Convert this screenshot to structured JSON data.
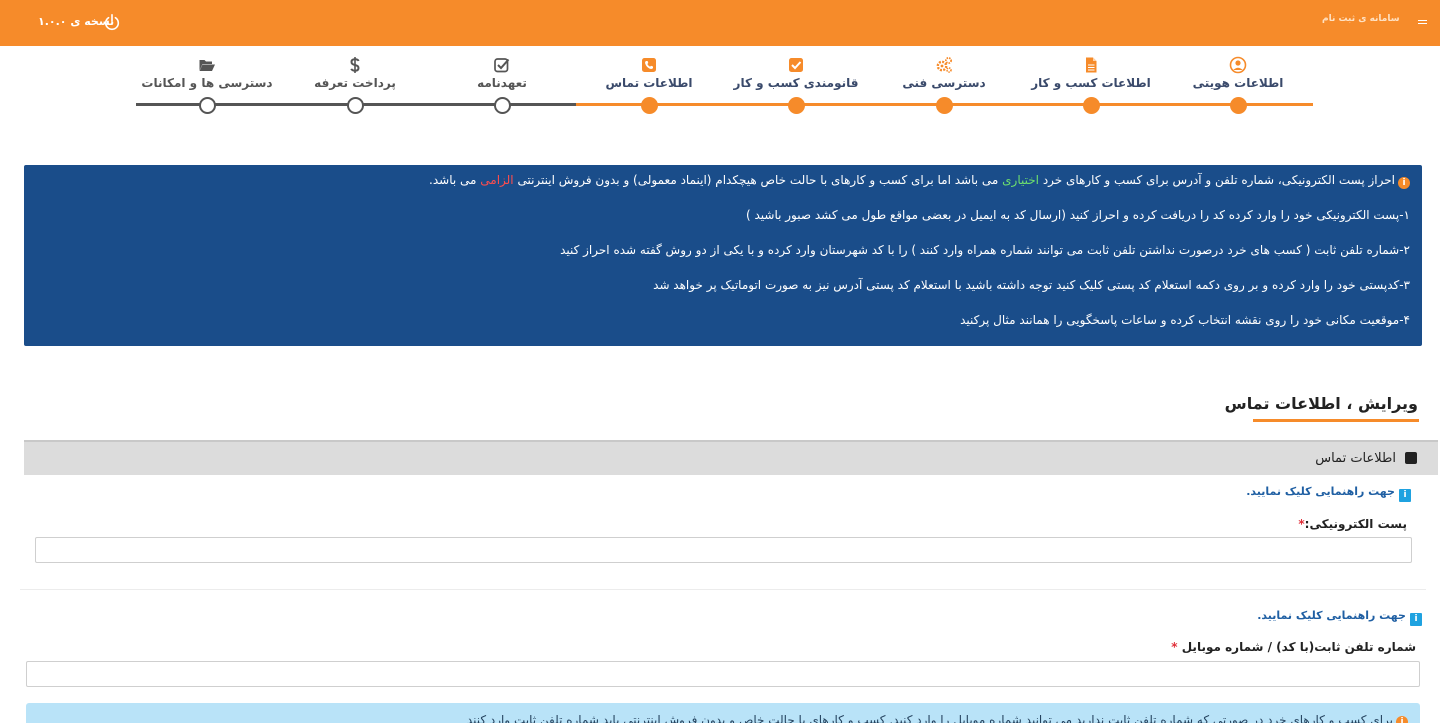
{
  "topbar": {
    "version": "نسخه ی ۱.۰.۰",
    "brand": "سامانه ی ثبت نام"
  },
  "colors": {
    "accent": "#f68b2a",
    "notice_bg": "#1a4d8a",
    "pending": "#555555"
  },
  "wizard": {
    "steps": [
      {
        "label": "اطلاعات هویتی",
        "icon": "user-circle-icon",
        "status": "done"
      },
      {
        "label": "اطلاعات کسب و کار",
        "icon": "document-icon",
        "status": "done"
      },
      {
        "label": "دسترسی فنی",
        "icon": "gears-icon",
        "status": "done"
      },
      {
        "label": "قانومندی کسب و کار",
        "icon": "check-square-icon",
        "status": "done"
      },
      {
        "label": "اطلاعات تماس",
        "icon": "phone-square-icon",
        "status": "current"
      },
      {
        "label": "تعهدنامه",
        "icon": "checkbox-outline-icon",
        "status": "todo"
      },
      {
        "label": "پرداخت تعرفه",
        "icon": "dollar-icon",
        "status": "todo"
      },
      {
        "label": "دسترسی ها و امکانات",
        "icon": "folder-open-icon",
        "status": "todo"
      }
    ]
  },
  "notice": {
    "intro_before": "احراز پست الکترونیکی، شماره تلفن و آدرس برای کسب و کارهای خرد ",
    "intro_optional": "اختیاری",
    "intro_middle": " می باشد اما برای کسب و کارهای با حالت خاص هیچکدام (اینماد معمولی) و بدون فروش اینترنتی ",
    "intro_required": "الزامی",
    "intro_after": " می باشد.",
    "items": [
      "۱-پست الکترونیکی خود را وارد کرده کد را دریافت کرده و احراز کنید (ارسال کد به ایمیل در بعضی مواقع طول می کشد صبور باشید )",
      "۲-شماره تلفن ثابت ( کسب های خرد درصورت نداشتن تلفن ثابت می توانند شماره همراه وارد کنند ) را با کد شهرستان وارد کرده و با یکی از دو روش گفته شده احراز کنید",
      "۳-کدپستی خود را وارد کرده و بر روی دکمه استعلام کد پستی کلیک کنید توجه داشته باشید با استعلام کد پستی آدرس نیز به صورت اتوماتیک پر خواهد شد",
      "۴-موقعیت مکانی خود را روی نقشه انتخاب کرده و ساعات پاسخگویی را همانند مثال پرکنید"
    ]
  },
  "section": {
    "title": "ویرایش ، اطلاعات تماس"
  },
  "panel": {
    "title": "اطلاعات تماس",
    "help_text": "جهت راهنمایی کلیک نمایید.",
    "email_label": "پست الکترونیکی:",
    "email_value": "",
    "phone_label": "شماره تلفن ثابت(با کد) / شماره موبایل ",
    "phone_value": "",
    "required_mark": "*"
  },
  "bottom_alert": {
    "text": "برای کسب و کارهای خرد در صورتی که شماره تلفن ثابت ندارید می توانید شماره موبایل را وارد کنید. کسب و کارهای با حالت خاص و بدون فروش اینترنتی باید شماره تلفن ثابت وارد کنند"
  }
}
